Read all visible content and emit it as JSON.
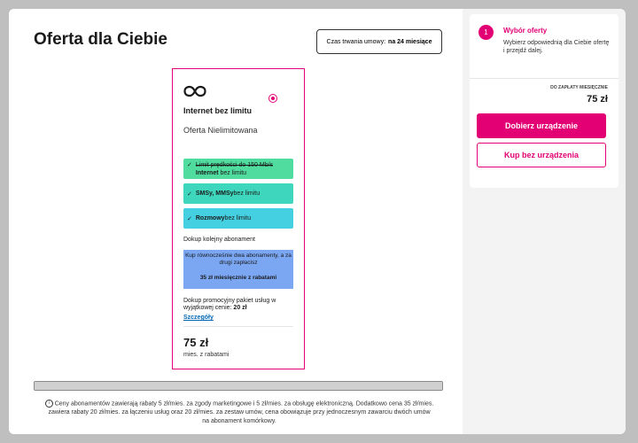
{
  "page": {
    "title": "Oferta dla Ciebie",
    "duration_label": "Czas trwania umowy:",
    "duration_value": "na 24 miesiące"
  },
  "offer_card": {
    "icon": "infinity-icon",
    "product_name": "Internet bez limitu",
    "offer_name": "Oferta Nielimitowana",
    "features": [
      {
        "strike": "Limit prędkości do 150 Mb/s",
        "bold": "Internet",
        "rest": " bez limitu"
      },
      {
        "bold": "SMSy, MMSy",
        "rest": " bez limitu"
      },
      {
        "bold": "Rozmowy",
        "rest": " bez limitu"
      }
    ],
    "extra_label": "Dokup kolejny abonament",
    "promo_text": "Kup równocześnie dwa abonamenty, a za drugi zapłacisz",
    "promo_price": "35 zł miesięcznie z rabatami",
    "promo_package_text": "Dokup promocyjny pakiet usług w wyjątkowej cenie:",
    "promo_package_price": "20 zł",
    "details_link": "Szczegóły",
    "price": "75 zł",
    "price_sub": "mies. z rabatami"
  },
  "colors": {
    "brand": "#e20074",
    "feature1": "#4fdc9e",
    "feature2": "#3ed6bc",
    "feature3": "#44d0e0",
    "promo_box": "#7aa6f2",
    "link": "#0066b3"
  },
  "footnote": "Ceny abonamentów zawierają rabaty 5 zł/mies. za zgody marketingowe i 5 zł/mies. za obsługę elektroniczną. Dodatkowo cena 35 zł/mies. zawiera rabaty 20 zł/mies. za łączeniu usług oraz 20 zł/mies. za zestaw umów, cena obowiązuje przy jednoczesnym zawarciu dwóch umów na abonament komórkowy.",
  "sidebar": {
    "step_number": "1",
    "step_title": "Wybór oferty",
    "step_desc": "Wybierz odpowiednią dla Ciebie ofertę i przejdź dalej.",
    "monthly_label": "DO ZAPŁATY MIESIĘCZNIE",
    "monthly_price": "75 zł",
    "primary_button": "Dobierz urządzenie",
    "secondary_button": "Kup bez urządzenia"
  }
}
